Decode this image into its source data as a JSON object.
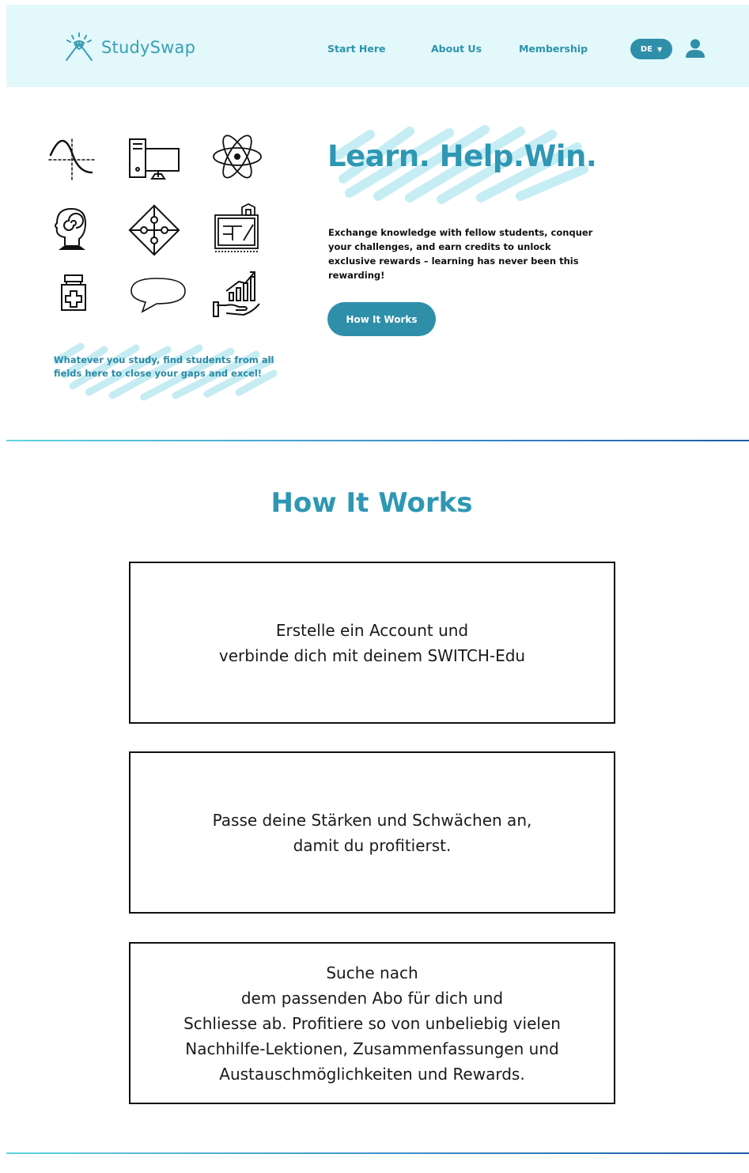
{
  "brand": {
    "name": "StudySwap",
    "accent": "#2e97b3",
    "header_bg": "#e3f8fb"
  },
  "nav": {
    "links": [
      {
        "label": "Start Here"
      },
      {
        "label": "About Us"
      },
      {
        "label": "Membership"
      }
    ],
    "language": {
      "selected": "DE",
      "caret": "▼"
    },
    "user_icon": "user-icon"
  },
  "hero": {
    "icons": [
      "graph-curve-icon",
      "computer-icon",
      "atom-icon",
      "head-spiral-icon",
      "puzzle-icon",
      "blueprint-icon",
      "medicine-bottle-icon",
      "speech-bubble-icon",
      "growth-hand-icon"
    ],
    "tagline": "Whatever you study, find students from all fields here to close your gaps and excel!",
    "headline": "Learn. Help.Win.",
    "intro": "Exchange knowledge with fellow students, conquer your challenges, and earn credits to unlock exclusive rewards – learning has never been this rewarding!",
    "cta_label": "How It Works"
  },
  "how_it_works": {
    "title": "How It Works",
    "steps": [
      {
        "lines": [
          "Erstelle ein Account und",
          "verbinde dich mit deinem SWITCH-Edu"
        ]
      },
      {
        "lines": [
          "Passe deine Stärken und Schwächen an,",
          "damit du profitierst."
        ]
      },
      {
        "lines": [
          "Suche nach",
          "dem passenden Abo für dich und",
          "Schliesse ab. Profitiere so von unbeliebig vielen",
          "Nachhilfe-Lektionen, Zusammenfassungen und",
          "Austauschmöglichkeiten und Rewards."
        ]
      }
    ]
  }
}
